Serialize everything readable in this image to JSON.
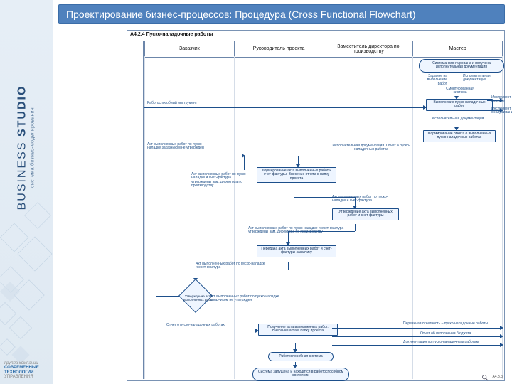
{
  "sidebar": {
    "logo_main_html": "BUSINESS <b>STUDIO</b>",
    "logo_sub": "система бизнес-моделирования",
    "footer_l1": "Группа компаний",
    "footer_l2": "СОВРЕМЕННЫЕ ТЕХНОЛОГИИ",
    "footer_l3": "УПРАВЛЕНИЯ"
  },
  "heading": "Проектирование бизнес-процессов: Процедура (Cross Functional Flowchart)",
  "diagram": {
    "title": "A4.2.4 Пуско-наладочные работы",
    "lanes": [
      "Заказчик",
      "Руководитель проекта",
      "Заместитель директора по производству",
      "Мастер"
    ],
    "corner_ref": "A4.3.3",
    "start_term": "Система смонтирована и получена исполнительная документация",
    "end_term_top": "Работоспособная система",
    "end_term_bot": "Система запущена и находится в работоспособном состоянии",
    "boxes": {
      "b1": "Выполнение пуско-наладочных работ",
      "b2": "Формирование отчета о выполненных пуско-наладочных работах",
      "b3": "Формирование акта выполненных работ и счет-фактуры. Внесение отчета в папку проекта",
      "b4": "Утверждение акта выполненных работ и счет-фактуры",
      "b5": "Передача акта выполненных работ и счет-фактуры заказчику",
      "b6": "Утверждение акта выполненных работ",
      "b7": "Получение акта выполненных работ. Внесение акта в папку проекта"
    },
    "notes": {
      "n_task": "Задание на выполнение работ",
      "n_exec_doc": "Исполнительная документация",
      "n_sys": "Смонтированная система",
      "n_tool_ok": "Работоспособный инструмент",
      "n_tool_chk": "Инструмент к поверке",
      "n_tool_srv": "Инструмент к обслуживанию",
      "n_exec_doc2": "Исполнительная документация",
      "n_ed_report": "Исполнительная документация. Отчет о пуско-наладочных работах",
      "n_act1": "Акт выполненных работ по пуско-наладке заказчиком не утвержден",
      "n_diam1": "Акт выполненных работ по пуско-наладке и счет-фактура утверждены зам. директора по производству",
      "n_act_cf": "Акт выполненных работ по пуско-наладке и счет-фактура",
      "n_act_cf2": "Акт выполненных работ по пуско-наладке и счет-фактура утверждены зам. директора по производству",
      "n_act_cf3": "Акт выполненных работ по пуско-наладке и счет-фактура",
      "n_diam2": "Акт выполненных работ по пуско-наладке заказчиком не утвержден",
      "n_report_out": "Отчет о пуско-наладочных работах",
      "n_primary": "Первичная отчетность – пуско-наладочные работы",
      "n_budget": "Отчет об исполнении бюджета",
      "n_docs": "Документация по пуско-наладочным работам"
    }
  }
}
